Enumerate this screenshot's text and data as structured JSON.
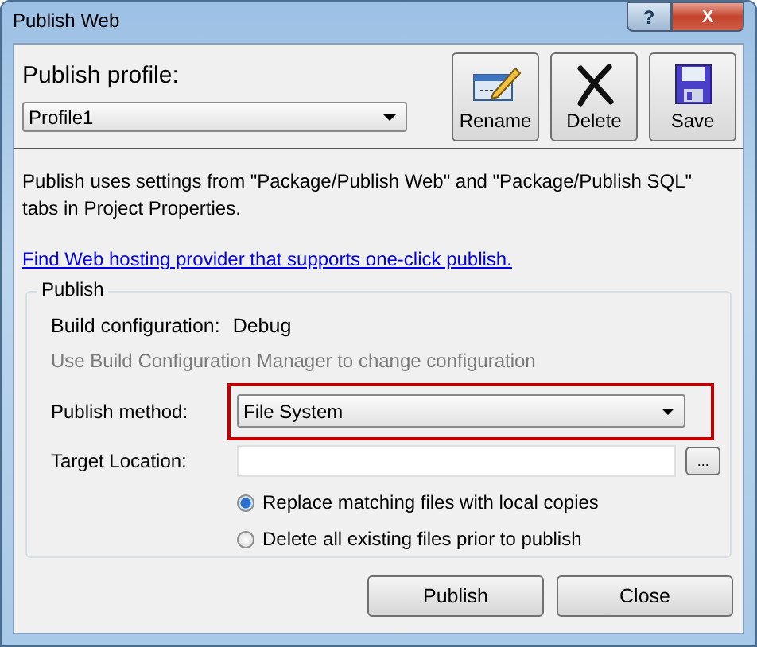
{
  "window": {
    "title": "Publish Web",
    "buttons": [
      "?",
      "X"
    ]
  },
  "profile": {
    "label": "Publish profile:",
    "value": "Profile1"
  },
  "toolbar": [
    {
      "kind": "rename",
      "label": "Rename"
    },
    {
      "kind": "delete",
      "label": "Delete"
    },
    {
      "kind": "save",
      "label": "Save"
    }
  ],
  "description": "Publish uses settings from \"Package/Publish Web\" and \"Package/Publish SQL\" tabs in Project Properties.",
  "link": "Find Web hosting provider that supports one-click publish.",
  "publish_group": {
    "title": "Publish",
    "build_configuration_label": "Build configuration:",
    "build_configuration_value": "Debug",
    "hint": "Use Build Configuration Manager to change configuration",
    "method_label": "Publish method:",
    "method_value": "File System",
    "method_highlighted": true,
    "target_label": "Target Location:",
    "browse_label": "...",
    "options": [
      {
        "label": "Replace matching files with local copies",
        "selected": true
      },
      {
        "label": "Delete all existing files prior to publish",
        "selected": false
      }
    ]
  },
  "buttons": [
    "Publish",
    "Close"
  ]
}
